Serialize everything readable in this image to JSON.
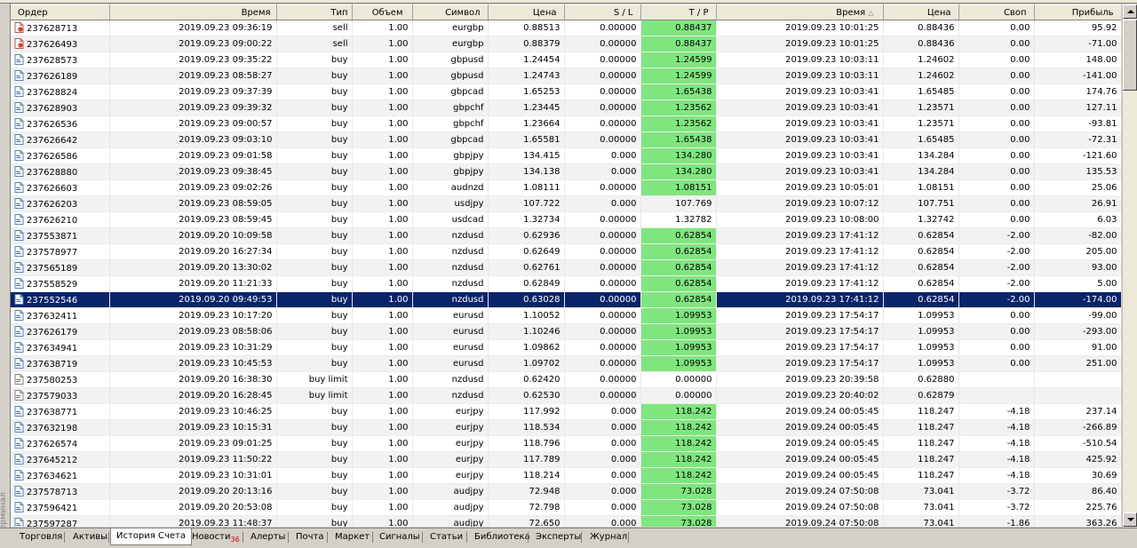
{
  "sidebar": {
    "label": "Терминал"
  },
  "columns": [
    "Ордер",
    "Время",
    "Тип",
    "Объем",
    "Символ",
    "Цена",
    "S / L",
    "T / P",
    "Время",
    "Цена",
    "Своп",
    "Прибыль"
  ],
  "sort_indicator": "△",
  "rows": [
    {
      "order": "237628713",
      "open_time": "2019.09.23 09:36:19",
      "type": "sell",
      "volume": "1.00",
      "symbol": "eurgbp",
      "open_price": "0.88513",
      "sl": "0.00000",
      "tp": "0.88437",
      "tp_hit": true,
      "close_time": "2019.09.23 10:01:25",
      "close_price": "0.88436",
      "swap": "0.00",
      "profit": "95.92",
      "icon": "sell-order-icon"
    },
    {
      "order": "237626493",
      "open_time": "2019.09.23 09:00:22",
      "type": "sell",
      "volume": "1.00",
      "symbol": "eurgbp",
      "open_price": "0.88379",
      "sl": "0.00000",
      "tp": "0.88437",
      "tp_hit": true,
      "close_time": "2019.09.23 10:01:25",
      "close_price": "0.88436",
      "swap": "0.00",
      "profit": "-71.00",
      "icon": "sell-order-icon"
    },
    {
      "order": "237628573",
      "open_time": "2019.09.23 09:35:22",
      "type": "buy",
      "volume": "1.00",
      "symbol": "gbpusd",
      "open_price": "1.24454",
      "sl": "0.00000",
      "tp": "1.24599",
      "tp_hit": true,
      "close_time": "2019.09.23 10:03:11",
      "close_price": "1.24602",
      "swap": "0.00",
      "profit": "148.00",
      "icon": "buy-order-icon"
    },
    {
      "order": "237626189",
      "open_time": "2019.09.23 08:58:27",
      "type": "buy",
      "volume": "1.00",
      "symbol": "gbpusd",
      "open_price": "1.24743",
      "sl": "0.00000",
      "tp": "1.24599",
      "tp_hit": true,
      "close_time": "2019.09.23 10:03:11",
      "close_price": "1.24602",
      "swap": "0.00",
      "profit": "-141.00",
      "icon": "buy-order-icon"
    },
    {
      "order": "237628824",
      "open_time": "2019.09.23 09:37:39",
      "type": "buy",
      "volume": "1.00",
      "symbol": "gbpcad",
      "open_price": "1.65253",
      "sl": "0.00000",
      "tp": "1.65438",
      "tp_hit": true,
      "close_time": "2019.09.23 10:03:41",
      "close_price": "1.65485",
      "swap": "0.00",
      "profit": "174.76",
      "icon": "buy-order-icon"
    },
    {
      "order": "237628903",
      "open_time": "2019.09.23 09:39:32",
      "type": "buy",
      "volume": "1.00",
      "symbol": "gbpchf",
      "open_price": "1.23445",
      "sl": "0.00000",
      "tp": "1.23562",
      "tp_hit": true,
      "close_time": "2019.09.23 10:03:41",
      "close_price": "1.23571",
      "swap": "0.00",
      "profit": "127.11",
      "icon": "buy-order-icon"
    },
    {
      "order": "237626536",
      "open_time": "2019.09.23 09:00:57",
      "type": "buy",
      "volume": "1.00",
      "symbol": "gbpchf",
      "open_price": "1.23664",
      "sl": "0.00000",
      "tp": "1.23562",
      "tp_hit": true,
      "close_time": "2019.09.23 10:03:41",
      "close_price": "1.23571",
      "swap": "0.00",
      "profit": "-93.81",
      "icon": "buy-order-icon"
    },
    {
      "order": "237626642",
      "open_time": "2019.09.23 09:03:10",
      "type": "buy",
      "volume": "1.00",
      "symbol": "gbpcad",
      "open_price": "1.65581",
      "sl": "0.00000",
      "tp": "1.65438",
      "tp_hit": true,
      "close_time": "2019.09.23 10:03:41",
      "close_price": "1.65485",
      "swap": "0.00",
      "profit": "-72.31",
      "icon": "buy-order-icon"
    },
    {
      "order": "237626586",
      "open_time": "2019.09.23 09:01:58",
      "type": "buy",
      "volume": "1.00",
      "symbol": "gbpjpy",
      "open_price": "134.415",
      "sl": "0.000",
      "tp": "134.280",
      "tp_hit": true,
      "close_time": "2019.09.23 10:03:41",
      "close_price": "134.284",
      "swap": "0.00",
      "profit": "-121.60",
      "icon": "buy-order-icon"
    },
    {
      "order": "237628880",
      "open_time": "2019.09.23 09:38:45",
      "type": "buy",
      "volume": "1.00",
      "symbol": "gbpjpy",
      "open_price": "134.138",
      "sl": "0.000",
      "tp": "134.280",
      "tp_hit": true,
      "close_time": "2019.09.23 10:03:41",
      "close_price": "134.284",
      "swap": "0.00",
      "profit": "135.53",
      "icon": "buy-order-icon"
    },
    {
      "order": "237626603",
      "open_time": "2019.09.23 09:02:26",
      "type": "buy",
      "volume": "1.00",
      "symbol": "audnzd",
      "open_price": "1.08111",
      "sl": "0.00000",
      "tp": "1.08151",
      "tp_hit": true,
      "close_time": "2019.09.23 10:05:01",
      "close_price": "1.08151",
      "swap": "0.00",
      "profit": "25.06",
      "icon": "buy-order-icon"
    },
    {
      "order": "237626203",
      "open_time": "2019.09.23 08:59:05",
      "type": "buy",
      "volume": "1.00",
      "symbol": "usdjpy",
      "open_price": "107.722",
      "sl": "0.000",
      "tp": "107.769",
      "tp_hit": false,
      "close_time": "2019.09.23 10:07:12",
      "close_price": "107.751",
      "swap": "0.00",
      "profit": "26.91",
      "icon": "buy-order-icon"
    },
    {
      "order": "237626210",
      "open_time": "2019.09.23 08:59:45",
      "type": "buy",
      "volume": "1.00",
      "symbol": "usdcad",
      "open_price": "1.32734",
      "sl": "0.00000",
      "tp": "1.32782",
      "tp_hit": false,
      "close_time": "2019.09.23 10:08:00",
      "close_price": "1.32742",
      "swap": "0.00",
      "profit": "6.03",
      "icon": "buy-order-icon"
    },
    {
      "order": "237553871",
      "open_time": "2019.09.20 10:09:58",
      "type": "buy",
      "volume": "1.00",
      "symbol": "nzdusd",
      "open_price": "0.62936",
      "sl": "0.00000",
      "tp": "0.62854",
      "tp_hit": true,
      "close_time": "2019.09.23 17:41:12",
      "close_price": "0.62854",
      "swap": "-2.00",
      "profit": "-82.00",
      "icon": "buy-order-icon"
    },
    {
      "order": "237578977",
      "open_time": "2019.09.20 16:27:34",
      "type": "buy",
      "volume": "1.00",
      "symbol": "nzdusd",
      "open_price": "0.62649",
      "sl": "0.00000",
      "tp": "0.62854",
      "tp_hit": true,
      "close_time": "2019.09.23 17:41:12",
      "close_price": "0.62854",
      "swap": "-2.00",
      "profit": "205.00",
      "icon": "buy-order-icon"
    },
    {
      "order": "237565189",
      "open_time": "2019.09.20 13:30:02",
      "type": "buy",
      "volume": "1.00",
      "symbol": "nzdusd",
      "open_price": "0.62761",
      "sl": "0.00000",
      "tp": "0.62854",
      "tp_hit": true,
      "close_time": "2019.09.23 17:41:12",
      "close_price": "0.62854",
      "swap": "-2.00",
      "profit": "93.00",
      "icon": "buy-order-icon"
    },
    {
      "order": "237558529",
      "open_time": "2019.09.20 11:21:33",
      "type": "buy",
      "volume": "1.00",
      "symbol": "nzdusd",
      "open_price": "0.62849",
      "sl": "0.00000",
      "tp": "0.62854",
      "tp_hit": true,
      "close_time": "2019.09.23 17:41:12",
      "close_price": "0.62854",
      "swap": "-2.00",
      "profit": "5.00",
      "icon": "buy-order-icon"
    },
    {
      "order": "237552546",
      "open_time": "2019.09.20 09:49:53",
      "type": "buy",
      "volume": "1.00",
      "symbol": "nzdusd",
      "open_price": "0.63028",
      "sl": "0.00000",
      "tp": "0.62854",
      "tp_hit": true,
      "close_time": "2019.09.23 17:41:12",
      "close_price": "0.62854",
      "swap": "-2.00",
      "profit": "-174.00",
      "icon": "buy-order-icon",
      "selected": true
    },
    {
      "order": "237632411",
      "open_time": "2019.09.23 10:17:20",
      "type": "buy",
      "volume": "1.00",
      "symbol": "eurusd",
      "open_price": "1.10052",
      "sl": "0.00000",
      "tp": "1.09953",
      "tp_hit": true,
      "close_time": "2019.09.23 17:54:17",
      "close_price": "1.09953",
      "swap": "0.00",
      "profit": "-99.00",
      "icon": "buy-order-icon"
    },
    {
      "order": "237626179",
      "open_time": "2019.09.23 08:58:06",
      "type": "buy",
      "volume": "1.00",
      "symbol": "eurusd",
      "open_price": "1.10246",
      "sl": "0.00000",
      "tp": "1.09953",
      "tp_hit": true,
      "close_time": "2019.09.23 17:54:17",
      "close_price": "1.09953",
      "swap": "0.00",
      "profit": "-293.00",
      "icon": "buy-order-icon"
    },
    {
      "order": "237634941",
      "open_time": "2019.09.23 10:31:29",
      "type": "buy",
      "volume": "1.00",
      "symbol": "eurusd",
      "open_price": "1.09862",
      "sl": "0.00000",
      "tp": "1.09953",
      "tp_hit": true,
      "close_time": "2019.09.23 17:54:17",
      "close_price": "1.09953",
      "swap": "0.00",
      "profit": "91.00",
      "icon": "buy-order-icon"
    },
    {
      "order": "237638719",
      "open_time": "2019.09.23 10:45:53",
      "type": "buy",
      "volume": "1.00",
      "symbol": "eurusd",
      "open_price": "1.09702",
      "sl": "0.00000",
      "tp": "1.09953",
      "tp_hit": true,
      "close_time": "2019.09.23 17:54:17",
      "close_price": "1.09953",
      "swap": "0.00",
      "profit": "251.00",
      "icon": "buy-order-icon"
    },
    {
      "order": "237580253",
      "open_time": "2019.09.20 16:38:30",
      "type": "buy limit",
      "volume": "1.00",
      "symbol": "nzdusd",
      "open_price": "0.62420",
      "sl": "0.00000",
      "tp": "0.00000",
      "tp_hit": false,
      "close_time": "2019.09.23 20:39:58",
      "close_price": "0.62880",
      "swap": "",
      "profit": "",
      "icon": "pending-order-icon"
    },
    {
      "order": "237579033",
      "open_time": "2019.09.20 16:28:45",
      "type": "buy limit",
      "volume": "1.00",
      "symbol": "nzdusd",
      "open_price": "0.62530",
      "sl": "0.00000",
      "tp": "0.00000",
      "tp_hit": false,
      "close_time": "2019.09.23 20:40:02",
      "close_price": "0.62879",
      "swap": "",
      "profit": "",
      "icon": "pending-order-icon"
    },
    {
      "order": "237638771",
      "open_time": "2019.09.23 10:46:25",
      "type": "buy",
      "volume": "1.00",
      "symbol": "eurjpy",
      "open_price": "117.992",
      "sl": "0.000",
      "tp": "118.242",
      "tp_hit": true,
      "close_time": "2019.09.24 00:05:45",
      "close_price": "118.247",
      "swap": "-4.18",
      "profit": "237.14",
      "icon": "buy-order-icon"
    },
    {
      "order": "237632198",
      "open_time": "2019.09.23 10:15:31",
      "type": "buy",
      "volume": "1.00",
      "symbol": "eurjpy",
      "open_price": "118.534",
      "sl": "0.000",
      "tp": "118.242",
      "tp_hit": true,
      "close_time": "2019.09.24 00:05:45",
      "close_price": "118.247",
      "swap": "-4.18",
      "profit": "-266.89",
      "icon": "buy-order-icon"
    },
    {
      "order": "237626574",
      "open_time": "2019.09.23 09:01:25",
      "type": "buy",
      "volume": "1.00",
      "symbol": "eurjpy",
      "open_price": "118.796",
      "sl": "0.000",
      "tp": "118.242",
      "tp_hit": true,
      "close_time": "2019.09.24 00:05:45",
      "close_price": "118.247",
      "swap": "-4.18",
      "profit": "-510.54",
      "icon": "buy-order-icon"
    },
    {
      "order": "237645212",
      "open_time": "2019.09.23 11:50:22",
      "type": "buy",
      "volume": "1.00",
      "symbol": "eurjpy",
      "open_price": "117.789",
      "sl": "0.000",
      "tp": "118.242",
      "tp_hit": true,
      "close_time": "2019.09.24 00:05:45",
      "close_price": "118.247",
      "swap": "-4.18",
      "profit": "425.92",
      "icon": "buy-order-icon"
    },
    {
      "order": "237634621",
      "open_time": "2019.09.23 10:31:01",
      "type": "buy",
      "volume": "1.00",
      "symbol": "eurjpy",
      "open_price": "118.214",
      "sl": "0.000",
      "tp": "118.242",
      "tp_hit": true,
      "close_time": "2019.09.24 00:05:45",
      "close_price": "118.247",
      "swap": "-4.18",
      "profit": "30.69",
      "icon": "buy-order-icon"
    },
    {
      "order": "237578713",
      "open_time": "2019.09.20 20:13:16",
      "type": "buy",
      "volume": "1.00",
      "symbol": "audjpy",
      "open_price": "72.948",
      "sl": "0.000",
      "tp": "73.028",
      "tp_hit": true,
      "close_time": "2019.09.24 07:50:08",
      "close_price": "73.041",
      "swap": "-3.72",
      "profit": "86.40",
      "icon": "buy-order-icon"
    },
    {
      "order": "237596421",
      "open_time": "2019.09.20 20:53:08",
      "type": "buy",
      "volume": "1.00",
      "symbol": "audjpy",
      "open_price": "72.798",
      "sl": "0.000",
      "tp": "73.028",
      "tp_hit": true,
      "close_time": "2019.09.24 07:50:08",
      "close_price": "73.041",
      "swap": "-3.72",
      "profit": "225.76",
      "icon": "buy-order-icon"
    },
    {
      "order": "237597287",
      "open_time": "2019.09.23 11:48:37",
      "type": "buy",
      "volume": "1.00",
      "symbol": "audjpy",
      "open_price": "72.650",
      "sl": "0.000",
      "tp": "73.028",
      "tp_hit": true,
      "close_time": "2019.09.24 07:50:08",
      "close_price": "73.041",
      "swap": "-1.86",
      "profit": "363.26",
      "icon": "buy-order-icon"
    }
  ],
  "tabs": [
    {
      "label": "Торговля",
      "active": false
    },
    {
      "label": "Активы",
      "active": false
    },
    {
      "label": "История Счета",
      "active": true
    },
    {
      "label": "Новости",
      "active": false,
      "badge": "36"
    },
    {
      "label": "Алерты",
      "active": false
    },
    {
      "label": "Почта",
      "active": false
    },
    {
      "label": "Маркет",
      "active": false
    },
    {
      "label": "Сигналы",
      "active": false
    },
    {
      "label": "Статьи",
      "active": false
    },
    {
      "label": "Библиотека",
      "active": false
    },
    {
      "label": "Эксперты",
      "active": false
    },
    {
      "label": "Журнал",
      "active": false
    }
  ],
  "colors": {
    "tp_hit": "#7fe67f",
    "selected_row": "#0a246a",
    "header_bg": "#ece9d8",
    "badge": "#d00000"
  }
}
